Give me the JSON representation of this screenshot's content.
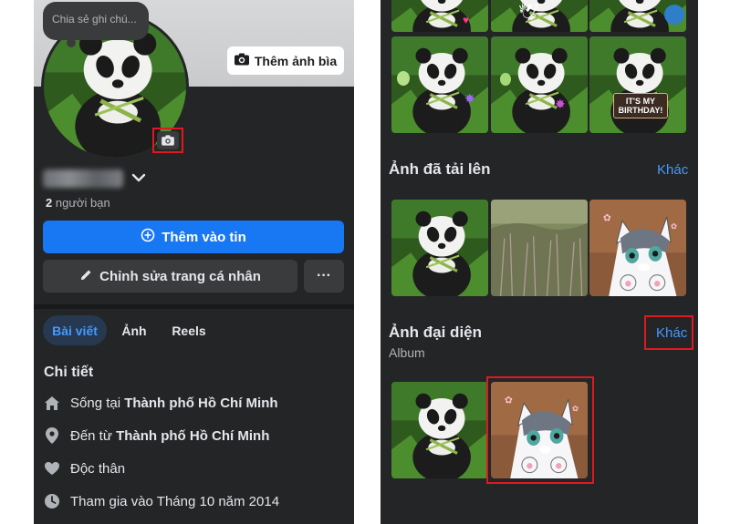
{
  "left": {
    "note_placeholder": "Chia sẻ ghi chú...",
    "add_cover_label": "Thêm ảnh bìa",
    "friends_count": "2",
    "friends_label": "người bạn",
    "add_story_label": "Thêm vào tin",
    "edit_profile_label": "Chỉnh sửa trang cá nhân",
    "more_label": "···",
    "tabs": [
      {
        "label": "Bài viết",
        "active": true
      },
      {
        "label": "Ảnh",
        "active": false
      },
      {
        "label": "Reels",
        "active": false
      }
    ],
    "details_title": "Chi tiết",
    "details": [
      {
        "icon": "home-icon",
        "prefix": "Sống tại ",
        "value": "Thành phố Hồ Chí Minh"
      },
      {
        "icon": "location-pin-icon",
        "prefix": "Đến từ ",
        "value": "Thành phố Hồ Chí Minh"
      },
      {
        "icon": "heart-icon",
        "prefix": "Độc thân",
        "value": ""
      },
      {
        "icon": "clock-icon",
        "prefix": "Tham gia vào Tháng 10 năm 2014",
        "value": ""
      }
    ]
  },
  "right": {
    "sticker_text": "IT'S MY BIRTHDAY!",
    "uploaded_title": "Ảnh đã tải lên",
    "uploaded_more": "Khác",
    "profile_pics_title": "Ảnh đại diện",
    "profile_pics_sub": "Album",
    "profile_pics_more": "Khác"
  },
  "colors": {
    "panel_bg": "#242526",
    "primary_blue": "#1877f2",
    "link_blue": "#4599ff",
    "highlight_red": "#e0181f"
  }
}
